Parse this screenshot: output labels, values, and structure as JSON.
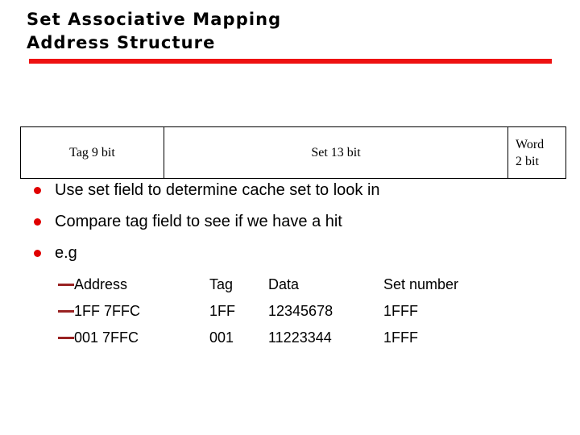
{
  "slide": {
    "title_lines": [
      "Set Associative Mapping",
      "Address Structure"
    ],
    "accent_color": "#ee1111",
    "bullet_color": "#e00000",
    "dash_color": "#992222",
    "background_color": "#ffffff",
    "text_color": "#000000"
  },
  "address_structure": {
    "fields": [
      {
        "name": "Tag",
        "size": "9 bit",
        "label": "Tag  9 bit"
      },
      {
        "name": "Set",
        "size": "13 bit",
        "label": "Set  13 bit"
      },
      {
        "name": "Word",
        "size": "2 bit",
        "label_line1": "Word",
        "label_line2": "2 bit"
      }
    ]
  },
  "bullets": [
    {
      "text": "Use set field to determine cache set to look in"
    },
    {
      "text": "Compare tag field to see if we have a hit"
    },
    {
      "text": "e.g"
    }
  ],
  "example_table": {
    "header": {
      "address": "Address",
      "tag": "Tag",
      "data": "Data",
      "set_number": "Set number"
    },
    "rows": [
      {
        "address": "1FF 7FFC",
        "tag": "1FF",
        "data": "12345678",
        "set_number": "1FFF"
      },
      {
        "address": "001 7FFC",
        "tag": "001",
        "data": "11223344",
        "set_number": "1FFF"
      }
    ]
  }
}
